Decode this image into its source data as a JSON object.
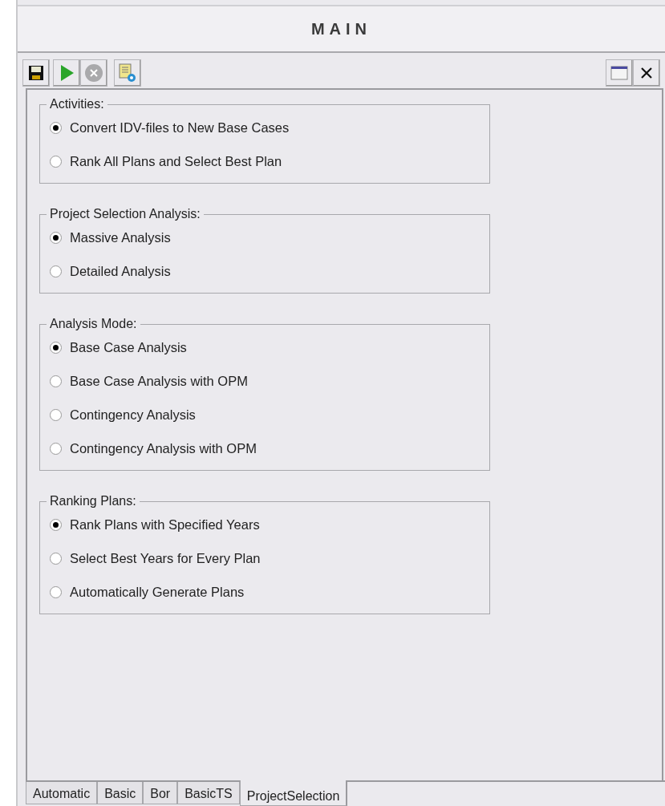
{
  "window": {
    "title": "MAIN"
  },
  "groups": [
    {
      "title": "Activities:",
      "options": [
        {
          "label": "Convert IDV-files to New Base Cases",
          "selected": true
        },
        {
          "label": "Rank All Plans and Select Best Plan",
          "selected": false
        }
      ]
    },
    {
      "title": "Project Selection Analysis:",
      "options": [
        {
          "label": "Massive Analysis",
          "selected": true
        },
        {
          "label": "Detailed Analysis",
          "selected": false
        }
      ]
    },
    {
      "title": "Analysis Mode:",
      "options": [
        {
          "label": "Base Case Analysis",
          "selected": true
        },
        {
          "label": "Base Case Analysis with OPM",
          "selected": false
        },
        {
          "label": "Contingency Analysis",
          "selected": false
        },
        {
          "label": "Contingency Analysis with OPM",
          "selected": false
        }
      ]
    },
    {
      "title": "Ranking Plans:",
      "options": [
        {
          "label": "Rank Plans with Specified Years",
          "selected": true
        },
        {
          "label": "Select Best Years for Every Plan",
          "selected": false
        },
        {
          "label": "Automatically Generate Plans",
          "selected": false
        }
      ]
    }
  ],
  "tabs": [
    {
      "label": "Automatic",
      "selected": false
    },
    {
      "label": "Basic",
      "selected": false
    },
    {
      "label": "Bor",
      "selected": false
    },
    {
      "label": "BasicTS",
      "selected": false
    },
    {
      "label": "ProjectSelection",
      "selected": true
    }
  ]
}
